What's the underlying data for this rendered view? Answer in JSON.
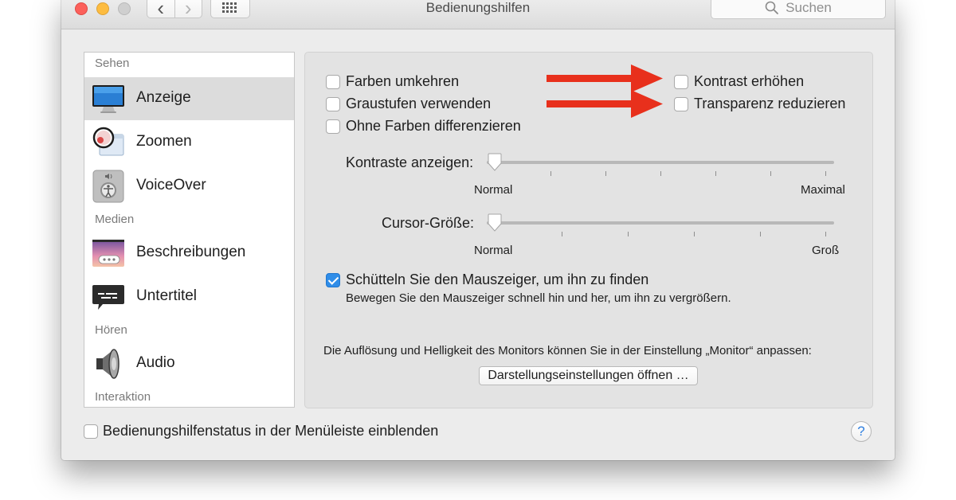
{
  "window": {
    "title": "Bedienungshilfen"
  },
  "toolbar": {
    "back_glyph": "‹",
    "forward_glyph": "›",
    "search_placeholder": "Suchen"
  },
  "sidebar": {
    "sections": [
      "Sehen",
      "Medien",
      "Hören",
      "Interaktion"
    ],
    "items": [
      {
        "label": "Anzeige",
        "icon": "display-icon",
        "selected": true
      },
      {
        "label": "Zoomen",
        "icon": "zoom-icon"
      },
      {
        "label": "VoiceOver",
        "icon": "voiceover-icon"
      },
      {
        "label": "Beschreibungen",
        "icon": "descriptions-icon"
      },
      {
        "label": "Untertitel",
        "icon": "captions-icon"
      },
      {
        "label": "Audio",
        "icon": "speaker-icon"
      }
    ]
  },
  "display": {
    "options_left": [
      {
        "label": "Farben umkehren",
        "checked": false
      },
      {
        "label": "Graustufen verwenden",
        "checked": false
      },
      {
        "label": "Ohne Farben differenzieren",
        "checked": false
      }
    ],
    "options_right": [
      {
        "label": "Kontrast erhöhen",
        "checked": false
      },
      {
        "label": "Transparenz reduzieren",
        "checked": false
      }
    ],
    "contrast_slider": {
      "label": "Kontraste anzeigen:",
      "min_label": "Normal",
      "max_label": "Maximal",
      "value": 0
    },
    "cursor_slider": {
      "label": "Cursor-Größe:",
      "min_label": "Normal",
      "max_label": "Groß",
      "value": 0
    },
    "shake": {
      "label": "Schütteln Sie den Mauszeiger, um ihn zu finden",
      "description": "Bewegen Sie den Mauszeiger schnell hin und her, um ihn zu vergrößern.",
      "checked": true
    },
    "monitor_note": "Die Auflösung und Helligkeit des Monitors können Sie in der Einstellung „Monitor“ anpassen:",
    "monitor_button": "Darstellungseinstellungen öffnen …"
  },
  "footer": {
    "menubar_status_label": "Bedienungshilfenstatus in der Menüleiste einblenden",
    "menubar_status_checked": false,
    "help": "?"
  },
  "annotations": {
    "arrow_color": "#e8301c"
  },
  "colors": {
    "accent": "#2f8de8"
  }
}
